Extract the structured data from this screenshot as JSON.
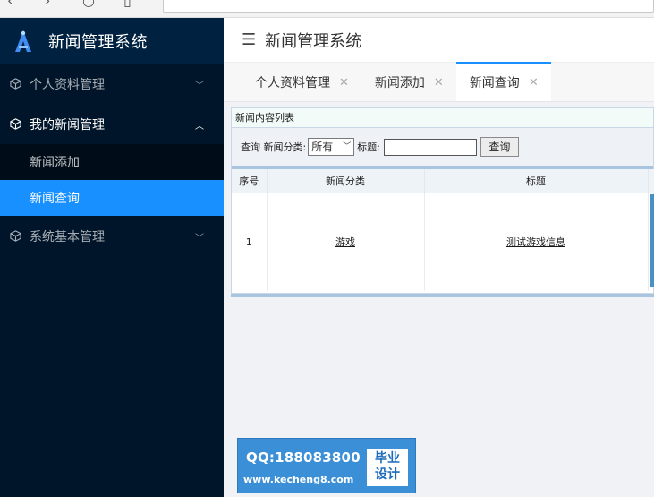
{
  "sidebar": {
    "title": "新闻管理系统",
    "groups": [
      {
        "label": "个人资料管理",
        "expanded": false
      },
      {
        "label": "我的新闻管理",
        "expanded": true
      },
      {
        "label": "系统基本管理",
        "expanded": false
      }
    ],
    "subitems": [
      {
        "label": "新闻添加",
        "active": false
      },
      {
        "label": "新闻查询",
        "active": true
      }
    ]
  },
  "topbar": {
    "title": "新闻管理系统"
  },
  "tabs": [
    {
      "label": "个人资料管理",
      "active": false
    },
    {
      "label": "新闻添加",
      "active": false
    },
    {
      "label": "新闻查询",
      "active": true
    }
  ],
  "panel": {
    "title": "新闻内容列表",
    "search": {
      "prefix": "查询 新闻分类:",
      "category_value": "所有",
      "title_label": "标题:",
      "title_value": "",
      "button": "查询"
    },
    "table": {
      "headers": [
        "序号",
        "新闻分类",
        "标题"
      ],
      "rows": [
        {
          "index": "1",
          "category": "游戏",
          "title": "测试游戏信息"
        }
      ]
    }
  },
  "watermark": {
    "qq": "QQ:188083800",
    "url": "www.kecheng8.com",
    "tag_line1": "毕业",
    "tag_line2": "设计"
  },
  "colors": {
    "sidebar_bg": "#001529",
    "accent": "#1890ff",
    "header_bg": "#002140"
  }
}
